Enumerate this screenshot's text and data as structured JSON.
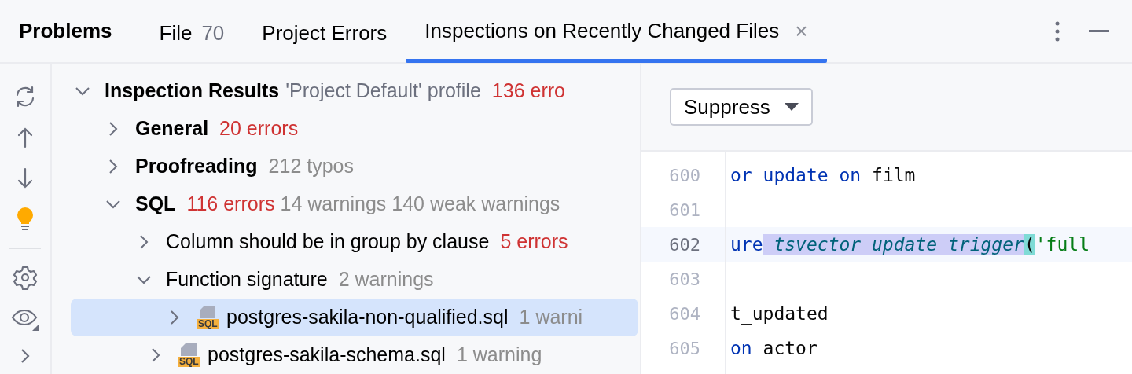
{
  "panel_title": "Problems",
  "tabs": [
    {
      "label": "File",
      "count": "70",
      "selected": false
    },
    {
      "label": "Project Errors",
      "selected": false
    },
    {
      "label": "Inspections on Recently Changed Files",
      "selected": true,
      "closable": true,
      "close_label": "×"
    }
  ],
  "tree": [
    {
      "kind": "root",
      "label": "Inspection Results",
      "note": "'Project Default' profile",
      "expanded": true,
      "counts": [
        {
          "text": "136 erro",
          "color": "#cf3333"
        }
      ],
      "children": [
        {
          "kind": "group",
          "label": "General",
          "expanded": false,
          "counts": [
            {
              "text": "20 errors",
              "color": "#cf3333"
            }
          ]
        },
        {
          "kind": "group",
          "label": "Proofreading",
          "expanded": false,
          "counts": [
            {
              "text": "212 typos",
              "color": "#8c8c8c"
            }
          ]
        },
        {
          "kind": "group",
          "label": "SQL",
          "expanded": true,
          "counts": [
            {
              "text": "116 errors",
              "color": "#cf3333"
            },
            {
              "text": "14 warnings",
              "color": "#8c8c8c"
            },
            {
              "text": "140 weak warnings",
              "color": "#8c8c8c"
            }
          ],
          "children": [
            {
              "kind": "inspection",
              "label": "Column should be in group by clause",
              "expanded": false,
              "counts": [
                {
                  "text": "5 errors",
                  "color": "#cf3333"
                }
              ]
            },
            {
              "kind": "inspection",
              "label": "Function signature",
              "expanded": true,
              "counts": [
                {
                  "text": "2 warnings",
                  "color": "#8c8c8c"
                }
              ],
              "children": [
                {
                  "kind": "file",
                  "label": "postgres-sakila-non-qualified.sql",
                  "expanded": false,
                  "selected": true,
                  "icon_label": "SQL",
                  "counts": [
                    {
                      "text": "1 warni",
                      "color": "#8c8c8c"
                    }
                  ]
                },
                {
                  "kind": "file",
                  "label": "postgres-sakila-schema.sql",
                  "expanded": false,
                  "selected": false,
                  "icon_label": "SQL",
                  "counts": [
                    {
                      "text": "1 warning",
                      "color": "#8c8c8c"
                    }
                  ]
                }
              ]
            }
          ]
        }
      ]
    }
  ],
  "suppress_button": "Suppress",
  "editor": {
    "lines": [
      {
        "number": "600",
        "current": false,
        "tokens": [
          {
            "text": "or",
            "kind": "keyword"
          },
          {
            "text": " update",
            "kind": "keyword"
          },
          {
            "text": " on",
            "kind": "keyword"
          },
          {
            "text": " film",
            "kind": "plain"
          }
        ]
      },
      {
        "number": "601",
        "current": false
      },
      {
        "number": "602",
        "current": true,
        "tokens": [
          {
            "text": "ure",
            "kind": "keyword"
          },
          {
            "text": " tsvector_update_trigger",
            "kind": "function"
          },
          {
            "text": "(",
            "kind": "paren"
          },
          {
            "text": "'full",
            "kind": "string"
          }
        ]
      },
      {
        "number": "603",
        "current": false
      },
      {
        "number": "604",
        "current": false,
        "tokens": [
          {
            "text": "t_updated",
            "kind": "plain"
          }
        ]
      },
      {
        "number": "605",
        "current": false,
        "tokens": [
          {
            "text": "on",
            "kind": "keyword"
          },
          {
            "text": " actor",
            "kind": "plain"
          }
        ]
      }
    ]
  }
}
